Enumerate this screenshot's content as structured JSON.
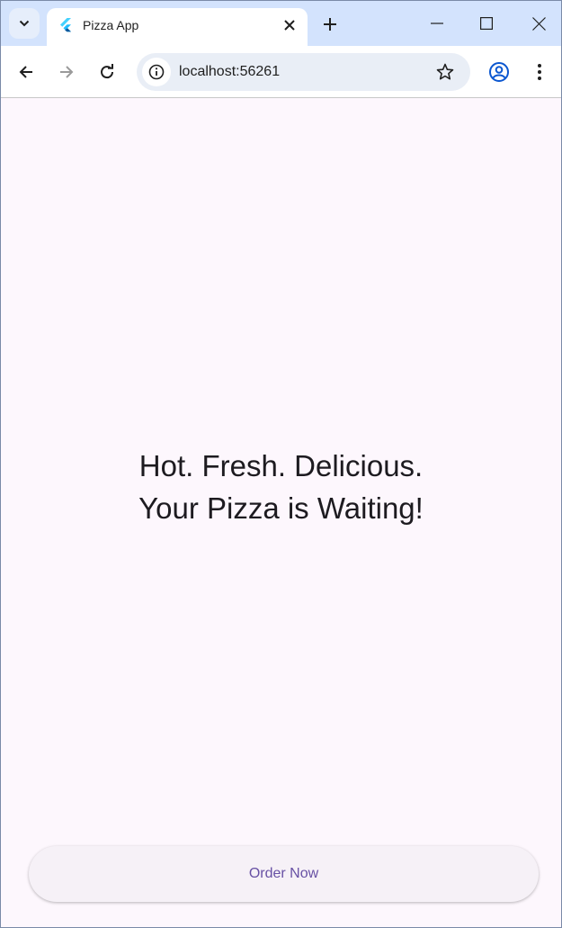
{
  "browser": {
    "tab": {
      "title": "Pizza App"
    },
    "address_bar": {
      "url": "localhost:56261"
    }
  },
  "page": {
    "headline_line1": "Hot. Fresh. Delicious.",
    "headline_line2": "Your Pizza is Waiting!",
    "order_button_label": "Order Now"
  },
  "colors": {
    "tabstrip_bg": "#d3e3fd",
    "page_bg": "#fdf7fd",
    "button_text": "#6750a4",
    "profile_icon": "#0b57d0"
  }
}
